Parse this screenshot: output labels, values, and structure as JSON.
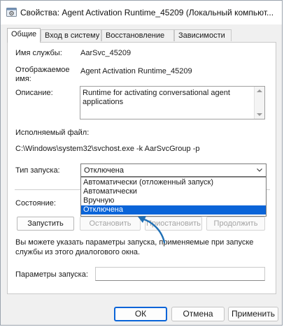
{
  "window": {
    "title": "Свойства: Agent Activation Runtime_45209 (Локальный компьют..."
  },
  "tabs": [
    {
      "label": "Общие",
      "active": true
    },
    {
      "label": "Вход в систему",
      "active": false
    },
    {
      "label": "Восстановление",
      "active": false
    },
    {
      "label": "Зависимости",
      "active": false
    }
  ],
  "general": {
    "service_name_label": "Имя службы:",
    "service_name_value": "AarSvc_45209",
    "display_name_label_1": "Отображаемое",
    "display_name_label_2": "имя:",
    "display_name_value": "Agent Activation Runtime_45209",
    "description_label": "Описание:",
    "description_line_1": "Runtime for activating conversational agent",
    "description_line_2": "applications",
    "exec_label": "Исполняемый файл:",
    "exec_path": "C:\\Windows\\system32\\svchost.exe -k AarSvcGroup -p",
    "startup_label": "Тип запуска:",
    "startup_selected": "Отключена",
    "startup_options": [
      "Автоматически (отложенный запуск)",
      "Автоматически",
      "Вручную",
      "Отключена"
    ],
    "state_label": "Состояние:",
    "buttons": {
      "start": "Запустить",
      "stop": "Остановить",
      "pause": "Приостановить",
      "resume": "Продолжить"
    },
    "hint_line_1": "Вы можете указать параметры запуска, применяемые при запуске",
    "hint_line_2": "службы из этого диалогового окна.",
    "params_label": "Параметры запуска:",
    "params_value": ""
  },
  "footer": {
    "ok": "ОК",
    "cancel": "Отмена",
    "apply": "Применить"
  },
  "colors": {
    "selection": "#0a64d8",
    "annotation_arrow": "#1f6fb5"
  }
}
